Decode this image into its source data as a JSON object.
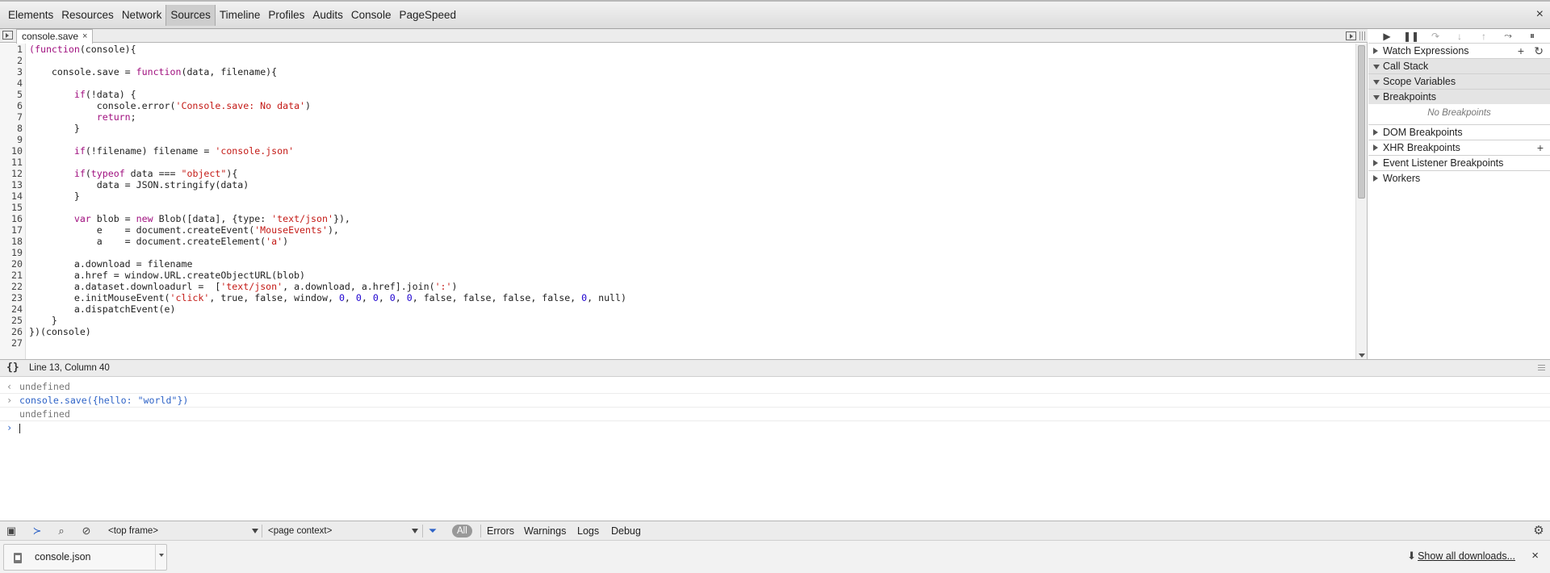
{
  "toolbar": {
    "tabs": [
      "Elements",
      "Resources",
      "Network",
      "Sources",
      "Timeline",
      "Profiles",
      "Audits",
      "Console",
      "PageSpeed"
    ],
    "selected_tab": "Sources",
    "close_label": "×"
  },
  "editor": {
    "file_tab": "console.save",
    "file_tab_close": "×",
    "lines": [
      {
        "n": "1",
        "parts": [
          [
            "kw",
            "(function"
          ],
          [
            "",
            "(console){"
          ]
        ]
      },
      {
        "n": "2",
        "parts": []
      },
      {
        "n": "3",
        "parts": [
          [
            "",
            "    console.save = "
          ],
          [
            "kw",
            "function"
          ],
          [
            "",
            "(data, filename){"
          ]
        ]
      },
      {
        "n": "4",
        "parts": []
      },
      {
        "n": "5",
        "parts": [
          [
            "",
            "        "
          ],
          [
            "kw",
            "if"
          ],
          [
            "",
            "(!data) {"
          ]
        ]
      },
      {
        "n": "6",
        "parts": [
          [
            "",
            "            console.error("
          ],
          [
            "str",
            "'Console.save: No data'"
          ],
          [
            "",
            ")"
          ]
        ]
      },
      {
        "n": "7",
        "parts": [
          [
            "",
            "            "
          ],
          [
            "kw",
            "return"
          ],
          [
            "",
            ";"
          ]
        ]
      },
      {
        "n": "8",
        "parts": [
          [
            "",
            "        }"
          ]
        ]
      },
      {
        "n": "9",
        "parts": []
      },
      {
        "n": "10",
        "parts": [
          [
            "",
            "        "
          ],
          [
            "kw",
            "if"
          ],
          [
            "",
            "(!filename) filename = "
          ],
          [
            "str",
            "'console.json'"
          ]
        ]
      },
      {
        "n": "11",
        "parts": []
      },
      {
        "n": "12",
        "parts": [
          [
            "",
            "        "
          ],
          [
            "kw",
            "if"
          ],
          [
            "",
            "("
          ],
          [
            "kw",
            "typeof"
          ],
          [
            "",
            " data === "
          ],
          [
            "str",
            "\"object\""
          ],
          [
            "",
            "){"
          ]
        ]
      },
      {
        "n": "13",
        "parts": [
          [
            "",
            "            data = JSON.stringify(data)"
          ]
        ]
      },
      {
        "n": "14",
        "parts": [
          [
            "",
            "        }"
          ]
        ]
      },
      {
        "n": "15",
        "parts": []
      },
      {
        "n": "16",
        "parts": [
          [
            "",
            "        "
          ],
          [
            "kw",
            "var"
          ],
          [
            "",
            " blob = "
          ],
          [
            "kw",
            "new"
          ],
          [
            "",
            " Blob([data], {type: "
          ],
          [
            "str",
            "'text/json'"
          ],
          [
            "",
            "}),"
          ]
        ]
      },
      {
        "n": "17",
        "parts": [
          [
            "",
            "            e    = document.createEvent("
          ],
          [
            "str",
            "'MouseEvents'"
          ],
          [
            "",
            "),"
          ]
        ]
      },
      {
        "n": "18",
        "parts": [
          [
            "",
            "            a    = document.createElement("
          ],
          [
            "str",
            "'a'"
          ],
          [
            "",
            ")"
          ]
        ]
      },
      {
        "n": "19",
        "parts": []
      },
      {
        "n": "20",
        "parts": [
          [
            "",
            "        a.download = filename"
          ]
        ]
      },
      {
        "n": "21",
        "parts": [
          [
            "",
            "        a.href = window.URL.createObjectURL(blob)"
          ]
        ]
      },
      {
        "n": "22",
        "parts": [
          [
            "",
            "        a.dataset.downloadurl =  ["
          ],
          [
            "str",
            "'text/json'"
          ],
          [
            "",
            ", a.download, a.href].join("
          ],
          [
            "str",
            "':'"
          ],
          [
            "",
            ")"
          ]
        ]
      },
      {
        "n": "23",
        "parts": [
          [
            "",
            "        e.initMouseEvent("
          ],
          [
            "str",
            "'click'"
          ],
          [
            "",
            ", true, false, window, "
          ],
          [
            "num",
            "0"
          ],
          [
            "",
            ", "
          ],
          [
            "num",
            "0"
          ],
          [
            "",
            ", "
          ],
          [
            "num",
            "0"
          ],
          [
            "",
            ", "
          ],
          [
            "num",
            "0"
          ],
          [
            "",
            ", "
          ],
          [
            "num",
            "0"
          ],
          [
            "",
            ", false, false, false, false, "
          ],
          [
            "num",
            "0"
          ],
          [
            "",
            ", null)"
          ]
        ]
      },
      {
        "n": "24",
        "parts": [
          [
            "",
            "        a.dispatchEvent(e)"
          ]
        ]
      },
      {
        "n": "25",
        "parts": [
          [
            "",
            "    }"
          ]
        ]
      },
      {
        "n": "26",
        "parts": [
          [
            "",
            "})(console)"
          ]
        ]
      },
      {
        "n": "27",
        "parts": []
      }
    ]
  },
  "sidebar": {
    "panes": [
      {
        "title": "Watch Expressions",
        "open": false,
        "actions": [
          "+",
          "↻"
        ]
      },
      {
        "title": "Call Stack",
        "open": true,
        "actions": []
      },
      {
        "title": "Scope Variables",
        "open": true,
        "actions": []
      },
      {
        "title": "Breakpoints",
        "open": true,
        "actions": []
      },
      {
        "title": "DOM Breakpoints",
        "open": false,
        "actions": []
      },
      {
        "title": "XHR Breakpoints",
        "open": false,
        "actions": [
          "+"
        ]
      },
      {
        "title": "Event Listener Breakpoints",
        "open": false,
        "actions": []
      },
      {
        "title": "Workers",
        "open": false,
        "actions": []
      }
    ],
    "no_breakpoints": "No Breakpoints"
  },
  "status": {
    "pretty_print": "{}",
    "position": "Line 13, Column 40"
  },
  "console": {
    "entries": [
      {
        "prefix": "‹",
        "text": "undefined",
        "kind": "res"
      },
      {
        "prefix": "›",
        "text": "console.save({hello: \"world\"})",
        "kind": "cmd"
      },
      {
        "prefix": "",
        "text": "undefined",
        "kind": "res"
      }
    ],
    "prompt": "›"
  },
  "consolebar": {
    "frame": "<top frame>",
    "context": "<page context>",
    "filters": [
      "All",
      "Errors",
      "Warnings",
      "Logs",
      "Debug"
    ]
  },
  "downloads": {
    "file": "console.json",
    "show_all": "Show all downloads...",
    "close": "×"
  }
}
